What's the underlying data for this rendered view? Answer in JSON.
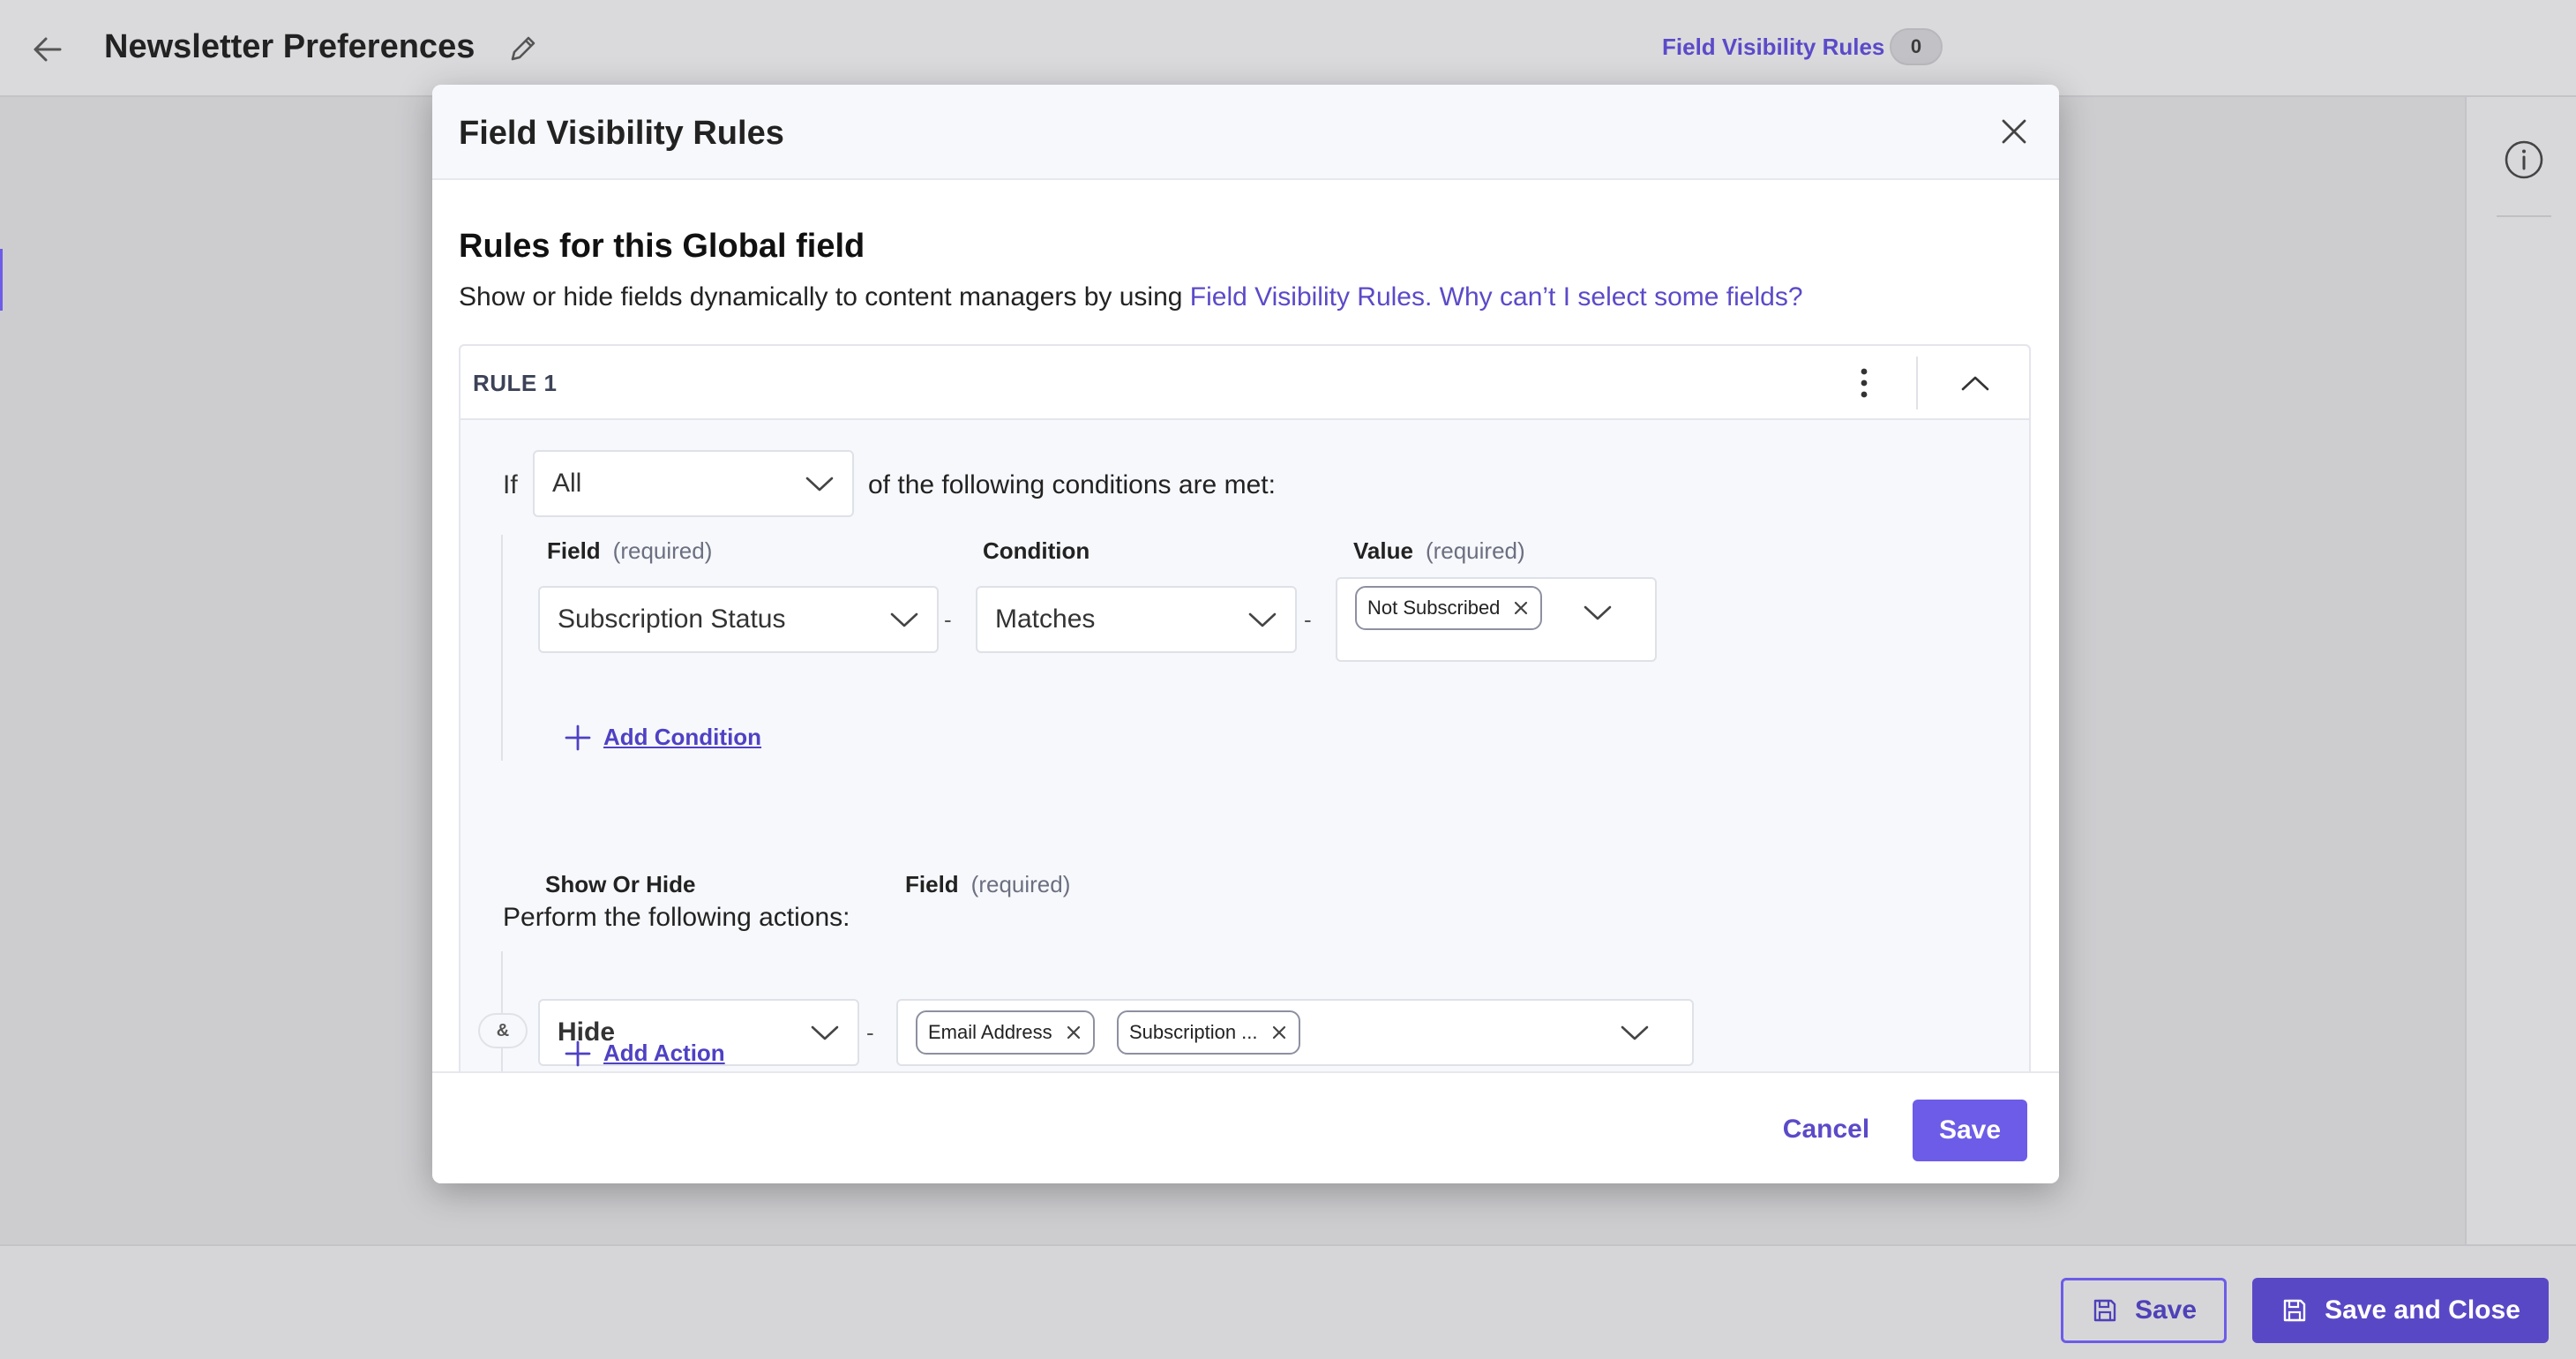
{
  "app": {
    "back_icon": "arrow-left-icon",
    "page_title": "Newsletter Preferences",
    "edit_icon": "pencil-icon",
    "fvr_link": "Field Visibility Rules",
    "fvr_count": "0",
    "info_icon": "info-circle-icon",
    "footer": {
      "save_label": "Save",
      "save_close_label": "Save and Close",
      "save_icon": "floppy-disk-icon"
    }
  },
  "modal": {
    "title": "Field Visibility Rules",
    "close_icon": "close-icon",
    "section_title": "Rules for this Global field",
    "description": "Show or hide fields dynamically to content managers by using ",
    "description_link_1": "Field Visibility Rules.",
    "description_link_2": "Why can’t I select some fields?",
    "rule": {
      "label": "RULE 1",
      "menu_icon": "kebab-menu-icon",
      "collapse_icon": "chevron-up-icon",
      "if_label": "If",
      "match_mode": "All",
      "conditions_text": "of the following conditions are met:",
      "condition_columns": {
        "field": "Field",
        "field_req": "(required)",
        "condition": "Condition",
        "value": "Value",
        "value_req": "(required)"
      },
      "conditions": [
        {
          "field": "Subscription Status",
          "operator": "Matches",
          "values": [
            "Not Subscribed"
          ]
        }
      ],
      "separator": "-",
      "add_condition": "Add Condition",
      "actions_title": "Perform the following actions:",
      "action_columns": {
        "show_or_hide": "Show Or Hide",
        "field": "Field",
        "field_req": "(required)"
      },
      "actions": [
        {
          "connector": "&",
          "mode": "Hide",
          "fields": [
            "Email Address",
            "Subscription ..."
          ]
        }
      ],
      "add_action": "Add Action"
    },
    "footer": {
      "cancel": "Cancel",
      "save": "Save"
    }
  },
  "colors": {
    "accent": "#6c5ce7",
    "link": "#5b4ac8",
    "overlay_bg": "#cdcdd0"
  }
}
